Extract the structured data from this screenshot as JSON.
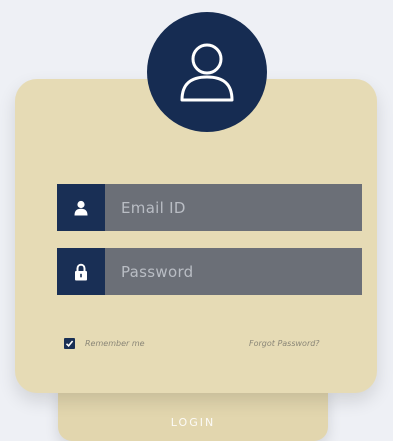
{
  "form": {
    "email_placeholder": "Email ID",
    "password_placeholder": "Password",
    "remember_label": "Remember me",
    "remember_checked": true,
    "forgot_label": "Forgot Password?",
    "login_label": "LOGIN"
  },
  "icons": {
    "avatar": "user-outline-icon",
    "email": "user-icon",
    "password": "lock-icon",
    "checkbox": "check-icon"
  },
  "colors": {
    "background": "#eef0f5",
    "card": "#e6dbb5",
    "accent_navy": "#162c52",
    "field": "#6b6f77"
  }
}
